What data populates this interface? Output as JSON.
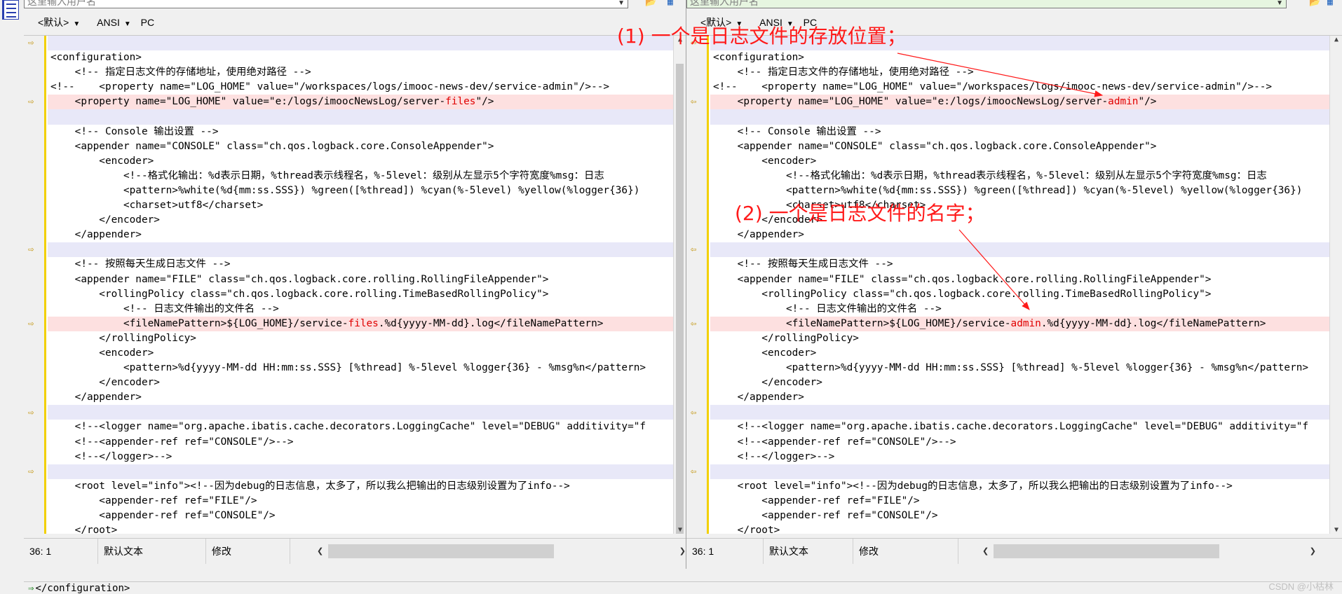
{
  "left_pane": {
    "path_placeholder": "这里输入用户名",
    "encoding": {
      "syntax": "<默认>",
      "charset": "ANSI",
      "newline": "PC"
    },
    "status": {
      "position": "36: 1",
      "type": "默认文本",
      "state": "修改"
    },
    "lines": [
      {
        "text": "",
        "bg": "blue",
        "marker": true
      },
      {
        "text": "<configuration>"
      },
      {
        "text": "    <!-- 指定日志文件的存储地址，使用绝对路径 -->"
      },
      {
        "text": "<!--    <property name=\"LOG_HOME\" value=\"/workspaces/logs/imooc-news-dev/service-admin\"/>-->"
      },
      {
        "text": "    <property name=\"LOG_HOME\" value=\"e:/logs/imoocNewsLog/server-",
        "hl": "files",
        "after": "\"/>",
        "bg": "pink",
        "marker": true
      },
      {
        "text": "",
        "bg": "blue"
      },
      {
        "text": "    <!-- Console 输出设置 -->"
      },
      {
        "text": "    <appender name=\"CONSOLE\" class=\"ch.qos.logback.core.ConsoleAppender\">"
      },
      {
        "text": "        <encoder>"
      },
      {
        "text": "            <!--格式化输出：%d表示日期，%thread表示线程名，%-5level：级别从左显示5个字符宽度%msg：日志"
      },
      {
        "text": "            <pattern>%white(%d{mm:ss.SSS}) %green([%thread]) %cyan(%-5level) %yellow(%logger{36})"
      },
      {
        "text": "            <charset>utf8</charset>"
      },
      {
        "text": "        </encoder>"
      },
      {
        "text": "    </appender>"
      },
      {
        "text": "",
        "bg": "blue",
        "marker": true
      },
      {
        "text": "    <!-- 按照每天生成日志文件 -->"
      },
      {
        "text": "    <appender name=\"FILE\" class=\"ch.qos.logback.core.rolling.RollingFileAppender\">"
      },
      {
        "text": "        <rollingPolicy class=\"ch.qos.logback.core.rolling.TimeBasedRollingPolicy\">"
      },
      {
        "text": "            <!-- 日志文件输出的文件名 -->"
      },
      {
        "text": "            <fileNamePattern>${LOG_HOME}/service-",
        "hl": "files",
        "after": ".%d{yyyy-MM-dd}.log</fileNamePattern>",
        "bg": "pink",
        "marker": true
      },
      {
        "text": "        </rollingPolicy>"
      },
      {
        "text": "        <encoder>"
      },
      {
        "text": "            <pattern>%d{yyyy-MM-dd HH:mm:ss.SSS} [%thread] %-5level %logger{36} - %msg%n</pattern>"
      },
      {
        "text": "        </encoder>"
      },
      {
        "text": "    </appender>"
      },
      {
        "text": "",
        "bg": "blue",
        "marker": true
      },
      {
        "text": "    <!--<logger name=\"org.apache.ibatis.cache.decorators.LoggingCache\" level=\"DEBUG\" additivity=\"f"
      },
      {
        "text": "    <!--<appender-ref ref=\"CONSOLE\"/>-->"
      },
      {
        "text": "    <!--</logger>-->"
      },
      {
        "text": "",
        "bg": "blue",
        "marker": true
      },
      {
        "text": "    <root level=\"info\"><!--因为debug的日志信息，太多了，所以我么把输出的日志级别设置为了info-->"
      },
      {
        "text": "        <appender-ref ref=\"FILE\"/>"
      },
      {
        "text": "        <appender-ref ref=\"CONSOLE\"/>"
      },
      {
        "text": "    </root>"
      },
      {
        "text": "</configuration>",
        "last": true
      }
    ]
  },
  "right_pane": {
    "path_placeholder": "这里输入用户名",
    "encoding": {
      "syntax": "<默认>",
      "charset": "ANSI",
      "newline": "PC"
    },
    "status": {
      "position": "36: 1",
      "type": "默认文本",
      "state": "修改"
    },
    "lines": [
      {
        "text": "",
        "bg": "blue",
        "marker": true
      },
      {
        "text": "<configuration>"
      },
      {
        "text": "    <!-- 指定日志文件的存储地址，使用绝对路径 -->"
      },
      {
        "text": "<!--    <property name=\"LOG_HOME\" value=\"/workspaces/logs/imooc-news-dev/service-admin\"/>-->"
      },
      {
        "text": "    <property name=\"LOG_HOME\" value=\"e:/logs/imoocNewsLog/server-",
        "hl": "admin",
        "after": "\"/>",
        "bg": "pink",
        "marker": true
      },
      {
        "text": "",
        "bg": "blue"
      },
      {
        "text": "    <!-- Console 输出设置 -->"
      },
      {
        "text": "    <appender name=\"CONSOLE\" class=\"ch.qos.logback.core.ConsoleAppender\">"
      },
      {
        "text": "        <encoder>"
      },
      {
        "text": "            <!--格式化输出：%d表示日期，%thread表示线程名，%-5level：级别从左显示5个字符宽度%msg：日志"
      },
      {
        "text": "            <pattern>%white(%d{mm:ss.SSS}) %green([%thread]) %cyan(%-5level) %yellow(%logger{36})"
      },
      {
        "text": "            <charset>utf8</charset>"
      },
      {
        "text": "        </encoder>"
      },
      {
        "text": "    </appender>"
      },
      {
        "text": "",
        "bg": "blue",
        "marker": true
      },
      {
        "text": "    <!-- 按照每天生成日志文件 -->"
      },
      {
        "text": "    <appender name=\"FILE\" class=\"ch.qos.logback.core.rolling.RollingFileAppender\">"
      },
      {
        "text": "        <rollingPolicy class=\"ch.qos.logback.core.rolling.TimeBasedRollingPolicy\">"
      },
      {
        "text": "            <!-- 日志文件输出的文件名 -->"
      },
      {
        "text": "            <fileNamePattern>${LOG_HOME}/service-",
        "hl": "admin",
        "after": ".%d{yyyy-MM-dd}.log</fileNamePattern>",
        "bg": "pink",
        "marker": true
      },
      {
        "text": "        </rollingPolicy>"
      },
      {
        "text": "        <encoder>"
      },
      {
        "text": "            <pattern>%d{yyyy-MM-dd HH:mm:ss.SSS} [%thread] %-5level %logger{36} - %msg%n</pattern>"
      },
      {
        "text": "        </encoder>"
      },
      {
        "text": "    </appender>"
      },
      {
        "text": "",
        "bg": "blue",
        "marker": true
      },
      {
        "text": "    <!--<logger name=\"org.apache.ibatis.cache.decorators.LoggingCache\" level=\"DEBUG\" additivity=\"f"
      },
      {
        "text": "    <!--<appender-ref ref=\"CONSOLE\"/>-->"
      },
      {
        "text": "    <!--</logger>-->"
      },
      {
        "text": "",
        "bg": "blue",
        "marker": true
      },
      {
        "text": "    <root level=\"info\"><!--因为debug的日志信息，太多了，所以我么把输出的日志级别设置为了info-->"
      },
      {
        "text": "        <appender-ref ref=\"FILE\"/>"
      },
      {
        "text": "        <appender-ref ref=\"CONSOLE\"/>"
      },
      {
        "text": "    </root>"
      },
      {
        "text": "</configuration>",
        "last": true
      }
    ]
  },
  "bottom_line": "</configuration>",
  "annotations": {
    "first": "(1) 一个是日志文件的存放位置；",
    "second": "(2) 一个是日志文件的名字；"
  },
  "watermark": "CSDN @小枯林",
  "colors": {
    "highlight_text": "#e00000",
    "diff_pink": "#fde0e0",
    "diff_blue": "#e8e8f8",
    "annotation": "#ff1a1a",
    "change_bar": "#f2d000"
  }
}
